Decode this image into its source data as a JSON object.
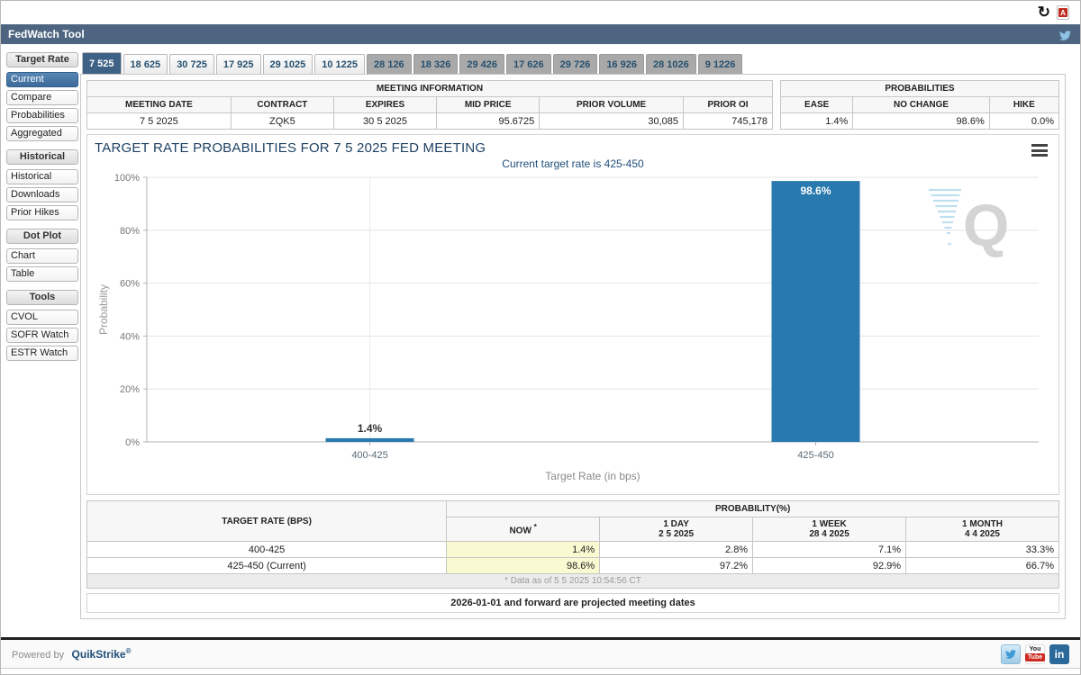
{
  "window": {
    "title": "FedWatch Tool"
  },
  "icons": {
    "refresh": "↻",
    "pdf_label": "A",
    "youtube_top": "You",
    "youtube_bottom": "Tube",
    "linkedin": "in"
  },
  "sidebar": {
    "sections": [
      {
        "header": "Target Rate",
        "items": [
          {
            "label": "Current",
            "selected": true
          },
          {
            "label": "Compare",
            "selected": false
          },
          {
            "label": "Probabilities",
            "selected": false
          },
          {
            "label": "Aggregated",
            "selected": false
          }
        ]
      },
      {
        "header": "Historical",
        "items": [
          {
            "label": "Historical",
            "selected": false
          },
          {
            "label": "Downloads",
            "selected": false
          },
          {
            "label": "Prior Hikes",
            "selected": false
          }
        ]
      },
      {
        "header": "Dot Plot",
        "items": [
          {
            "label": "Chart",
            "selected": false
          },
          {
            "label": "Table",
            "selected": false
          }
        ]
      },
      {
        "header": "Tools",
        "items": [
          {
            "label": "CVOL",
            "selected": false
          },
          {
            "label": "SOFR Watch",
            "selected": false
          },
          {
            "label": "ESTR Watch",
            "selected": false
          }
        ]
      }
    ]
  },
  "tabs": [
    {
      "label": "7 525",
      "state": "selected"
    },
    {
      "label": "18 625",
      "state": "near"
    },
    {
      "label": "30 725",
      "state": "near"
    },
    {
      "label": "17 925",
      "state": "near"
    },
    {
      "label": "29 1025",
      "state": "near"
    },
    {
      "label": "10 1225",
      "state": "near"
    },
    {
      "label": "28 126",
      "state": "far"
    },
    {
      "label": "18 326",
      "state": "far"
    },
    {
      "label": "29 426",
      "state": "far"
    },
    {
      "label": "17 626",
      "state": "far"
    },
    {
      "label": "29 726",
      "state": "far"
    },
    {
      "label": "16 926",
      "state": "far"
    },
    {
      "label": "28 1026",
      "state": "far"
    },
    {
      "label": "9 1226",
      "state": "far"
    }
  ],
  "meeting_info": {
    "title": "MEETING INFORMATION",
    "columns": [
      "MEETING DATE",
      "CONTRACT",
      "EXPIRES",
      "MID PRICE",
      "PRIOR VOLUME",
      "PRIOR OI"
    ],
    "values": [
      "7 5 2025",
      "ZQK5",
      "30 5 2025",
      "95.6725",
      "30,085",
      "745,178"
    ],
    "align": [
      "c",
      "c",
      "c",
      "r",
      "r",
      "r"
    ],
    "widths": [
      "21%",
      "15%",
      "15%",
      "15%",
      "21%",
      "13%"
    ]
  },
  "probabilities_summary": {
    "title": "PROBABILITIES",
    "columns": [
      "EASE",
      "NO CHANGE",
      "HIKE"
    ],
    "values": [
      "1.4%",
      "98.6%",
      "0.0%"
    ],
    "align": [
      "r",
      "r",
      "r"
    ],
    "widths": [
      "26%",
      "49%",
      "25%"
    ]
  },
  "chart_data": {
    "type": "bar",
    "title": "TARGET RATE PROBABILITIES FOR 7 5 2025 FED MEETING",
    "subtitle": "Current target rate is 425-450",
    "categories": [
      "400-425",
      "425-450"
    ],
    "values": [
      1.4,
      98.6
    ],
    "bar_labels": [
      "1.4%",
      "98.6%"
    ],
    "xlabel": "Target Rate (in bps)",
    "ylabel": "Probability",
    "ylim": [
      0,
      100
    ],
    "yticks": [
      0,
      20,
      40,
      60,
      80,
      100
    ],
    "ytick_labels": [
      "0%",
      "20%",
      "40%",
      "60%",
      "80%",
      "100%"
    ],
    "grid": true,
    "legend": "none",
    "bar_color": "#2779ae",
    "watermark": "Q"
  },
  "probability_table": {
    "col1_header": "TARGET RATE (BPS)",
    "group_header": "PROBABILITY(%)",
    "columns": [
      {
        "line1": "NOW",
        "sup": "*",
        "line2": ""
      },
      {
        "line1": "1 DAY",
        "line2": "2 5 2025"
      },
      {
        "line1": "1 WEEK",
        "line2": "28 4 2025"
      },
      {
        "line1": "1 MONTH",
        "line2": "4 4 2025"
      }
    ],
    "rows": [
      {
        "rate": "400-425",
        "values": [
          "1.4%",
          "2.8%",
          "7.1%",
          "33.3%"
        ]
      },
      {
        "rate": "425-450 (Current)",
        "values": [
          "98.6%",
          "97.2%",
          "92.9%",
          "66.7%"
        ]
      }
    ],
    "footnote": "* Data as of 5 5 2025 10:54:56 CT"
  },
  "note": "2026-01-01 and forward are projected meeting dates",
  "footer": {
    "powered_by": "Powered by",
    "brand": "QuikStrike",
    "reg": "®"
  },
  "colors": {
    "titlebar_bg": "#4e6582",
    "selected_blue": "#3d6286",
    "bar_blue": "#2779ae",
    "link_blue": "#1f4e79",
    "highlight_yellow": "#fafad2",
    "tab_gray": "#a9a9a9",
    "title_navy": "#1e4164"
  }
}
